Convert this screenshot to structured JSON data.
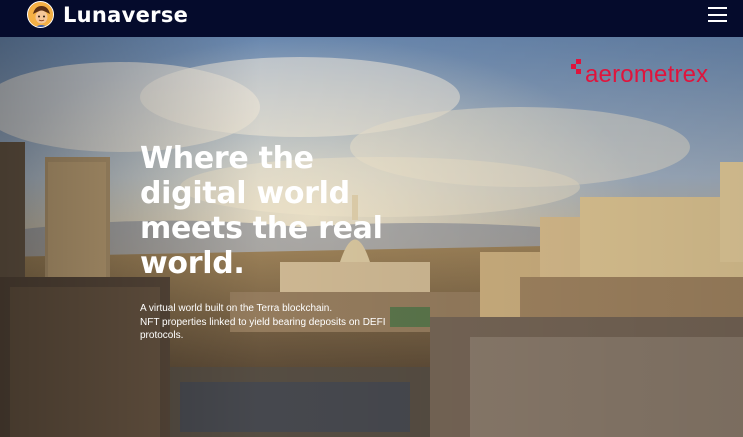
{
  "navbar": {
    "brand": "Lunaverse",
    "logo_icon": "avatar-character-icon",
    "menu_icon": "hamburger-menu-icon"
  },
  "hero": {
    "headline_lines": [
      "Where the",
      "digital world",
      "meets the real",
      "world."
    ],
    "subtext_lines": [
      "A virtual world built on the Terra blockchain.",
      "NFT properties linked to yield bearing deposits on DEFI",
      "protocols."
    ],
    "sponsor": "aerometrex"
  },
  "colors": {
    "navbar_bg": "#050b2c",
    "sponsor_red": "#e0143c",
    "text": "#ffffff"
  }
}
